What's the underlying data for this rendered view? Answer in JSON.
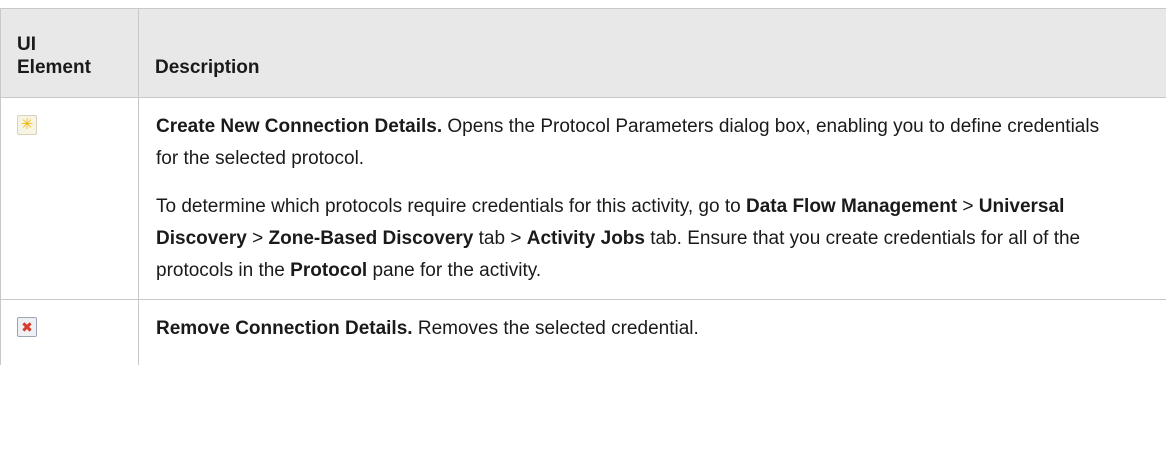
{
  "table": {
    "headers": {
      "ui_element_line1": "UI",
      "ui_element_line2": "Element",
      "description": "Description"
    },
    "rows": [
      {
        "icon": "new-star-icon",
        "p1": {
          "bold_title": "Create New Connection Details.",
          "text": " Opens the Protocol Parameters dialog box, enabling you to define credentials for the selected protocol."
        },
        "p2": {
          "t1": "To determine which protocols require credentials for this activity, go to ",
          "b1": "Data Flow Management",
          "t2": " > ",
          "b2": "Universal Discovery",
          "t3": " > ",
          "b3": "Zone-Based Discovery",
          "t4": " tab > ",
          "b4": "Activity Jobs",
          "t5": " tab. Ensure that you create credentials for all of the protocols in the ",
          "b5": "Protocol",
          "t6": " pane for the activity."
        }
      },
      {
        "icon": "remove-x-icon",
        "p1": {
          "bold_title": "Remove Connection Details.",
          "text": " Removes the selected credential."
        }
      }
    ]
  }
}
